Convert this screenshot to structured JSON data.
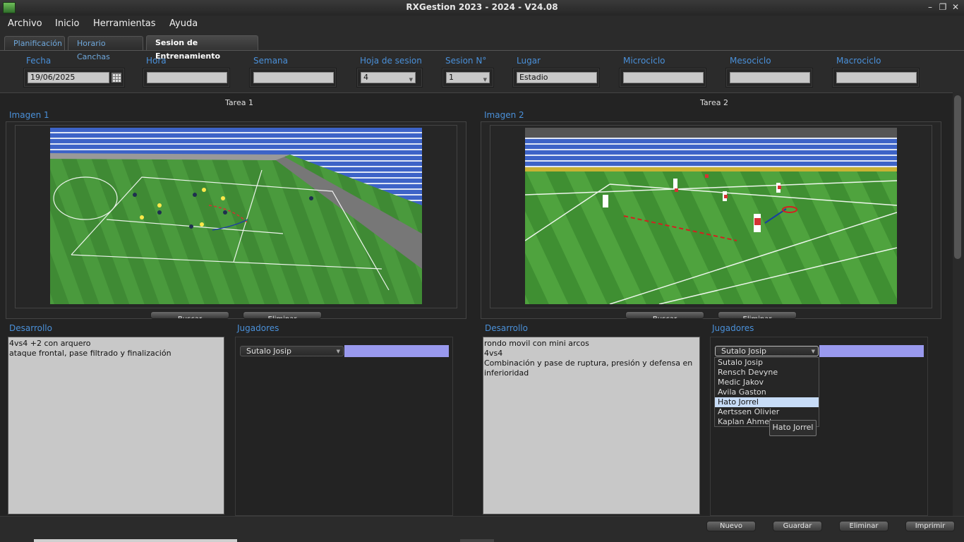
{
  "window": {
    "title": "RXGestion 2023 - 2024 - V24.08"
  },
  "menu": [
    "Archivo",
    "Inicio",
    "Herramientas",
    "Ayuda"
  ],
  "tabs": [
    "Planificación",
    "Horario Canchas",
    "Sesion de Entrenamiento"
  ],
  "fields": {
    "fecha": {
      "label": "Fecha",
      "value": "19/06/2025"
    },
    "hora": {
      "label": "Hora",
      "value": ""
    },
    "semana": {
      "label": "Semana",
      "value": ""
    },
    "hoja": {
      "label": "Hoja de sesion",
      "value": "4"
    },
    "sesion": {
      "label": "Sesion N°",
      "value": "1"
    },
    "lugar": {
      "label": "Lugar",
      "value": "Estadio"
    },
    "micro": {
      "label": "Microciclo",
      "value": ""
    },
    "meso": {
      "label": "Mesociclo",
      "value": ""
    },
    "macro": {
      "label": "Macrociclo",
      "value": ""
    }
  },
  "tarea1": {
    "title": "Tarea 1",
    "imagen_label": "Imagen 1",
    "buscar": "Buscar",
    "eliminar": "Eliminar",
    "desarrollo_label": "Desarrollo",
    "desarrollo_lines": [
      "4vs4 +2 con arquero",
      "ataque frontal, pase filtrado y finalización"
    ],
    "jugadores_label": "Jugadores",
    "jugador_selected": "Sutalo Josip"
  },
  "tarea2": {
    "title": "Tarea 2",
    "imagen_label": "Imagen 2",
    "buscar": "Buscar",
    "eliminar": "Eliminar",
    "desarrollo_label": "Desarrollo",
    "desarrollo_lines": [
      "rondo movil con mini arcos",
      "4vs4",
      "Combinación y pase de ruptura, presión y defensa en",
      "inferioridad"
    ],
    "jugadores_label": "Jugadores",
    "jugador_selected": "Sutalo Josip",
    "dropdown_options": [
      "Sutalo Josip",
      "Rensch Devyne",
      "Medic Jakov",
      "Avila Gaston",
      "Hato Jorrel",
      "Aertssen Olivier",
      "Kaplan Ahmetcan"
    ],
    "dropdown_highlighted": "Hato Jorrel",
    "tooltip": "Hato Jorrel"
  },
  "actions": {
    "nuevo": "Nuevo",
    "guardar": "Guardar",
    "eliminar": "Eliminar",
    "imprimir": "Imprimir"
  },
  "colors": {
    "accent_label": "#4a90d9",
    "tab_inactive": "#6fa8dc",
    "player_bar": "#9999ee",
    "dropdown_highlight": "#c7dcf7"
  }
}
